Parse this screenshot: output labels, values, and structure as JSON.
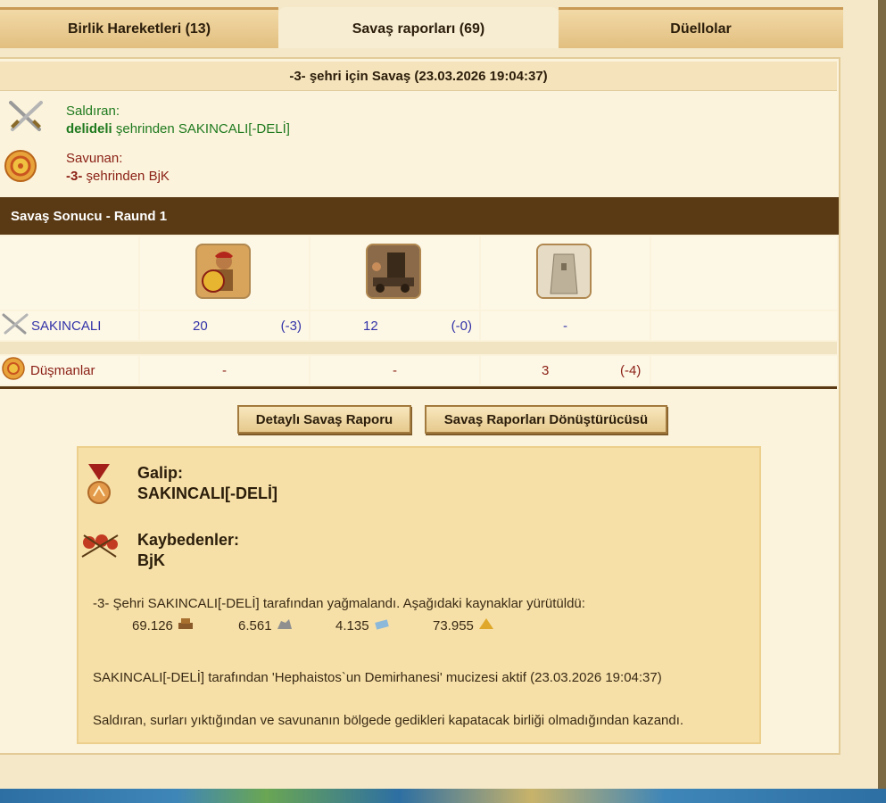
{
  "tabs": [
    {
      "label": "Birlik Hareketleri (13)"
    },
    {
      "label": "Savaş raporları (69)"
    },
    {
      "label": "Düellolar"
    }
  ],
  "report": {
    "title": "-3- şehri için Savaş (23.03.2026 19:04:37)",
    "attacker": {
      "label": "Saldıran:",
      "city": "delideli",
      "text": "şehrinden SAKINCALI[-DELİ]"
    },
    "defender": {
      "label": "Savunan:",
      "city": "-3-",
      "text": "şehrinden BjK"
    }
  },
  "result": {
    "header": "Savaş Sonucu - Raund 1",
    "rows": [
      {
        "name": "SAKINCALI",
        "cells": [
          {
            "count": "20",
            "loss": "(-3)"
          },
          {
            "count": "12",
            "loss": "(-0)"
          },
          {
            "count": "-",
            "loss": ""
          }
        ]
      },
      {
        "name": "Düşmanlar",
        "cells": [
          {
            "count": "-",
            "loss": ""
          },
          {
            "count": "-",
            "loss": ""
          },
          {
            "count": "3",
            "loss": "(-4)"
          }
        ]
      }
    ]
  },
  "buttons": {
    "detailed": "Detaylı Savaş Raporu",
    "converter": "Savaş Raporları Dönüştürücüsü"
  },
  "summary": {
    "winner_label": "Galip:",
    "winner": "SAKINCALI[-DELİ]",
    "losers_label": "Kaybedenler:",
    "losers": "BjK",
    "plunder_text": "-3- Şehri SAKINCALI[-DELİ] tarafından yağmalandı. Aşağıdaki kaynaklar yürütüldü:",
    "resources": [
      {
        "value": "69.126",
        "icon": "wood-icon"
      },
      {
        "value": "6.561",
        "icon": "stone-icon"
      },
      {
        "value": "4.135",
        "icon": "silver-icon"
      },
      {
        "value": "73.955",
        "icon": "favor-icon"
      }
    ],
    "miracle_text": "SAKINCALI[-DELİ] tarafından 'Hephaistos`un Demirhanesi' mucizesi aktif (23.03.2026 19:04:37)",
    "victory_text": "Saldıran, surları yıktığından ve savunanın bölgede gedikleri kapatacak birliği olmadığından kazandı."
  },
  "colors": {
    "attacker": "#1f7a1f",
    "defender": "#8a1f14",
    "header_bg": "#5a3a14",
    "unit_count": "#3333a8"
  }
}
